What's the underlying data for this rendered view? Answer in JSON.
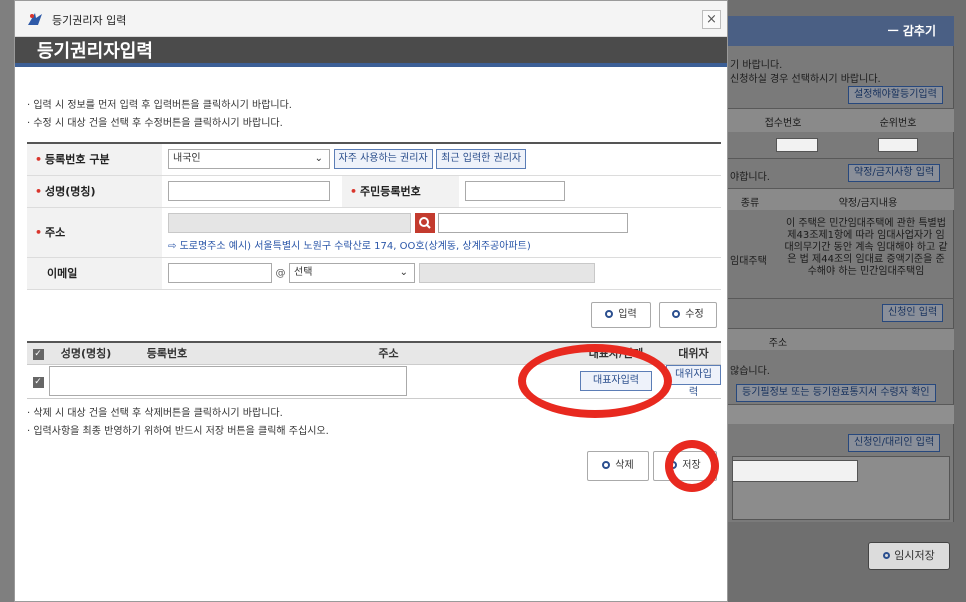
{
  "window": {
    "title": "등기권리자 입력",
    "close": "×"
  },
  "heading": "등기권리자입력",
  "notes": [
    "입력 시 정보를 먼저 입력 후 입력버튼을 클릭하시기 바랍니다.",
    "수정 시 대상 건을 선택 후 수정버튼을 클릭하시기 바랍니다."
  ],
  "form": {
    "reg_type_label": "등록번호 구분",
    "reg_type_value": "내국인",
    "freq_btn": "자주 사용하는 권리자",
    "recent_btn": "최근 입력한 권리자",
    "name_label": "성명(명칭)",
    "id_label": "주민등록번호",
    "address_label": "주소",
    "address_hint": "도로명주소 예시) 서울특별시 노원구 수락산로 174, OO호(상계동, 상계주공아파트)",
    "email_label": "이메일",
    "email_at": "@",
    "email_select": "선택"
  },
  "buttons": {
    "input": "입력",
    "edit": "수정",
    "delete": "삭제",
    "save": "저장"
  },
  "list": {
    "headers": [
      "성명(명칭)",
      "등록번호",
      "주소",
      "대표자/관계",
      "대위자"
    ],
    "rep_btn": "대표자입력",
    "sub_btn": "대위자입력"
  },
  "bottom_notes": [
    "삭제 시 대상 건을 선택 후 삭제버튼을 클릭하시기 바랍니다.",
    "입력사항을 최종 반영하기 위하여 반드시 저장 버튼을 클릭해 주십시오."
  ],
  "background": {
    "header": "ㅡ 감추기",
    "line1": "기 바랍니다.",
    "line2": "신청하실 경우 선택하시기 바랍니다.",
    "btn1": "설정해야할등기입력",
    "col_receipt": "접수번호",
    "col_rank": "순위번호",
    "line3": "야합니다.",
    "btn2": "약정/금지사항 입력",
    "col_kind": "종류",
    "col_terms": "약정/금지내용",
    "kind_value": "임대주택",
    "terms_text": "이 주택은 민간임대주택에 관한 특별법 제43조제1항에 따라 임대사업자가 임대의무기간 동안 계속 임대해야 하고 같은 법 제44조의 임대료 증액기준을 준수해야 하는 민간임대주택임",
    "btn3": "신청인 입력",
    "col_address": "주소",
    "line4": "않습니다.",
    "btn4": "등기필정보 또는 등기완료통지서 수령자 확인",
    "btn5": "신청인/대리인 입력",
    "temp_save": "임시저장"
  },
  "colors": {
    "accent": "#3c5f96",
    "required": "#d9352c",
    "highlight": "#e8291f"
  }
}
